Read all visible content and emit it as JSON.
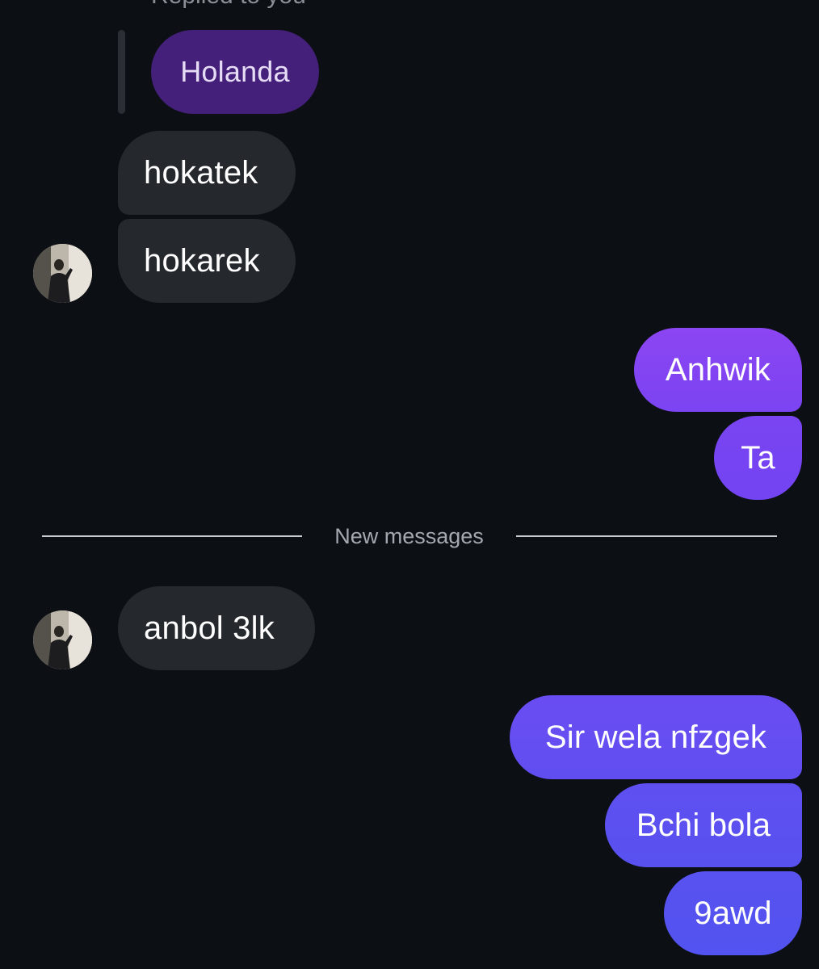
{
  "thread": {
    "replied_label": "Replied to you",
    "quoted_message": "Holanda",
    "divider_label": "New messages"
  },
  "messages": [
    {
      "id": "m1",
      "direction": "incoming",
      "text": "hokatek"
    },
    {
      "id": "m2",
      "direction": "incoming",
      "text": "hokarek",
      "avatar": true
    },
    {
      "id": "m3",
      "direction": "outgoing",
      "text": "Anhwik"
    },
    {
      "id": "m4",
      "direction": "outgoing",
      "text": "Ta"
    },
    {
      "id": "m5",
      "direction": "incoming",
      "text": "anbol 3lk",
      "avatar": true
    },
    {
      "id": "m6",
      "direction": "outgoing",
      "text": "Sir wela nfzgek"
    },
    {
      "id": "m7",
      "direction": "outgoing",
      "text": "Bchi bola"
    },
    {
      "id": "m8",
      "direction": "outgoing",
      "text": "9awd"
    }
  ],
  "colors": {
    "background": "#0c0f14",
    "incoming_bubble": "#25282d",
    "quoted_bubble": "#44207a",
    "outgoing_gradient_top": "#8c45f2",
    "outgoing_gradient_bottom": "#5253f0"
  },
  "icons": {
    "avatar": "user-photo-avatar"
  }
}
